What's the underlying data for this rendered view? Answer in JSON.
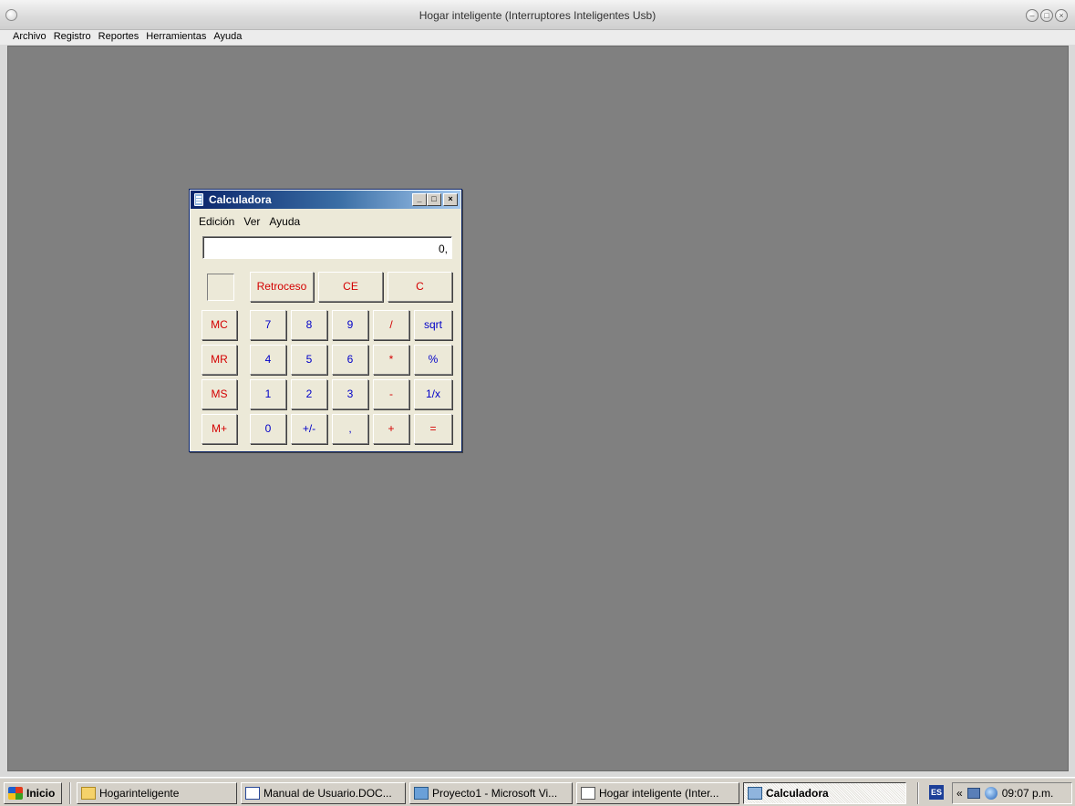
{
  "app": {
    "title": "Hogar inteligente (Interruptores Inteligentes Usb)",
    "menu": [
      "Archivo",
      "Registro",
      "Reportes",
      "Herramientas",
      "Ayuda"
    ],
    "controls": [
      "minimize-icon",
      "maximize-icon",
      "close-icon"
    ]
  },
  "calculator": {
    "title": "Calculadora",
    "menu": [
      "Edición",
      "Ver",
      "Ayuda"
    ],
    "display": "0,",
    "window_controls": {
      "minimize": "_",
      "maximize": "□",
      "close": "×"
    },
    "top_buttons": [
      "Retroceso",
      "CE",
      "C"
    ],
    "memory_buttons": [
      "MC",
      "MR",
      "MS",
      "M+"
    ],
    "keypad": [
      [
        "7",
        "8",
        "9",
        "/",
        "sqrt"
      ],
      [
        "4",
        "5",
        "6",
        "*",
        "%"
      ],
      [
        "1",
        "2",
        "3",
        "-",
        "1/x"
      ],
      [
        "0",
        "+/-",
        ",",
        "+",
        "="
      ]
    ],
    "colors": {
      "operator": "#d40000",
      "digit": "#0000c8"
    }
  },
  "taskbar": {
    "start": "Inicio",
    "tasks": [
      {
        "label": "Hogarinteligente",
        "icon": "folder-icon"
      },
      {
        "label": "Manual de Usuario.DOC...",
        "icon": "word-document-icon"
      },
      {
        "label": "Proyecto1 - Microsoft Vi...",
        "icon": "visual-basic-icon"
      },
      {
        "label": "Hogar inteligente (Inter...",
        "icon": "document-icon"
      },
      {
        "label": "Calculadora",
        "icon": "calculator-icon",
        "active": true
      }
    ],
    "language": "ES",
    "clock": "09:07 p.m."
  }
}
